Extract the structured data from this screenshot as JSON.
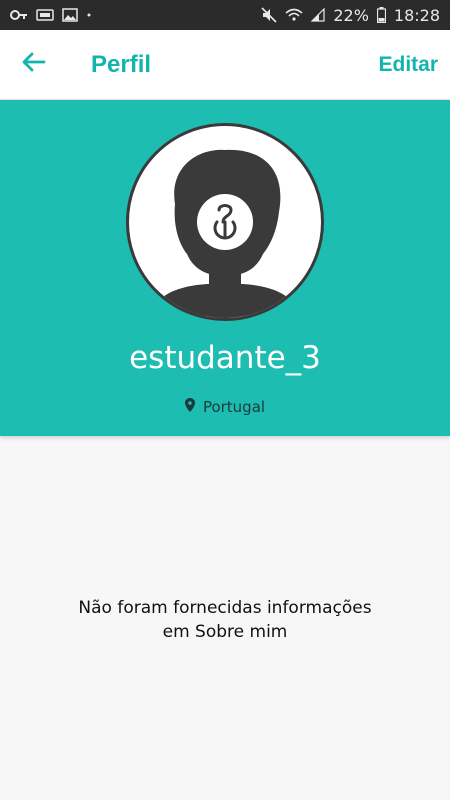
{
  "status_bar": {
    "battery": "22%",
    "time": "18:28",
    "icons_left": [
      "key-icon",
      "vpn-icon",
      "image-icon",
      "dot-icon"
    ],
    "icons_right": [
      "mute-icon",
      "wifi-icon",
      "signal-icon",
      "battery-icon"
    ]
  },
  "app_bar": {
    "title": "Perfil",
    "edit_label": "Editar",
    "back_icon": "arrow-left-icon"
  },
  "profile": {
    "username": "estudante_3",
    "location": "Portugal",
    "location_icon": "map-pin-icon",
    "avatar": "default-avatar-silhouette"
  },
  "about": {
    "line1": "Não foram fornecidas informações",
    "line2": "em Sobre mim"
  },
  "colors": {
    "accent": "#11b5ad",
    "header_bg": "#1dbdb2",
    "status_bar_bg": "#2b2b2b",
    "body_bg": "#f7f7f7"
  }
}
